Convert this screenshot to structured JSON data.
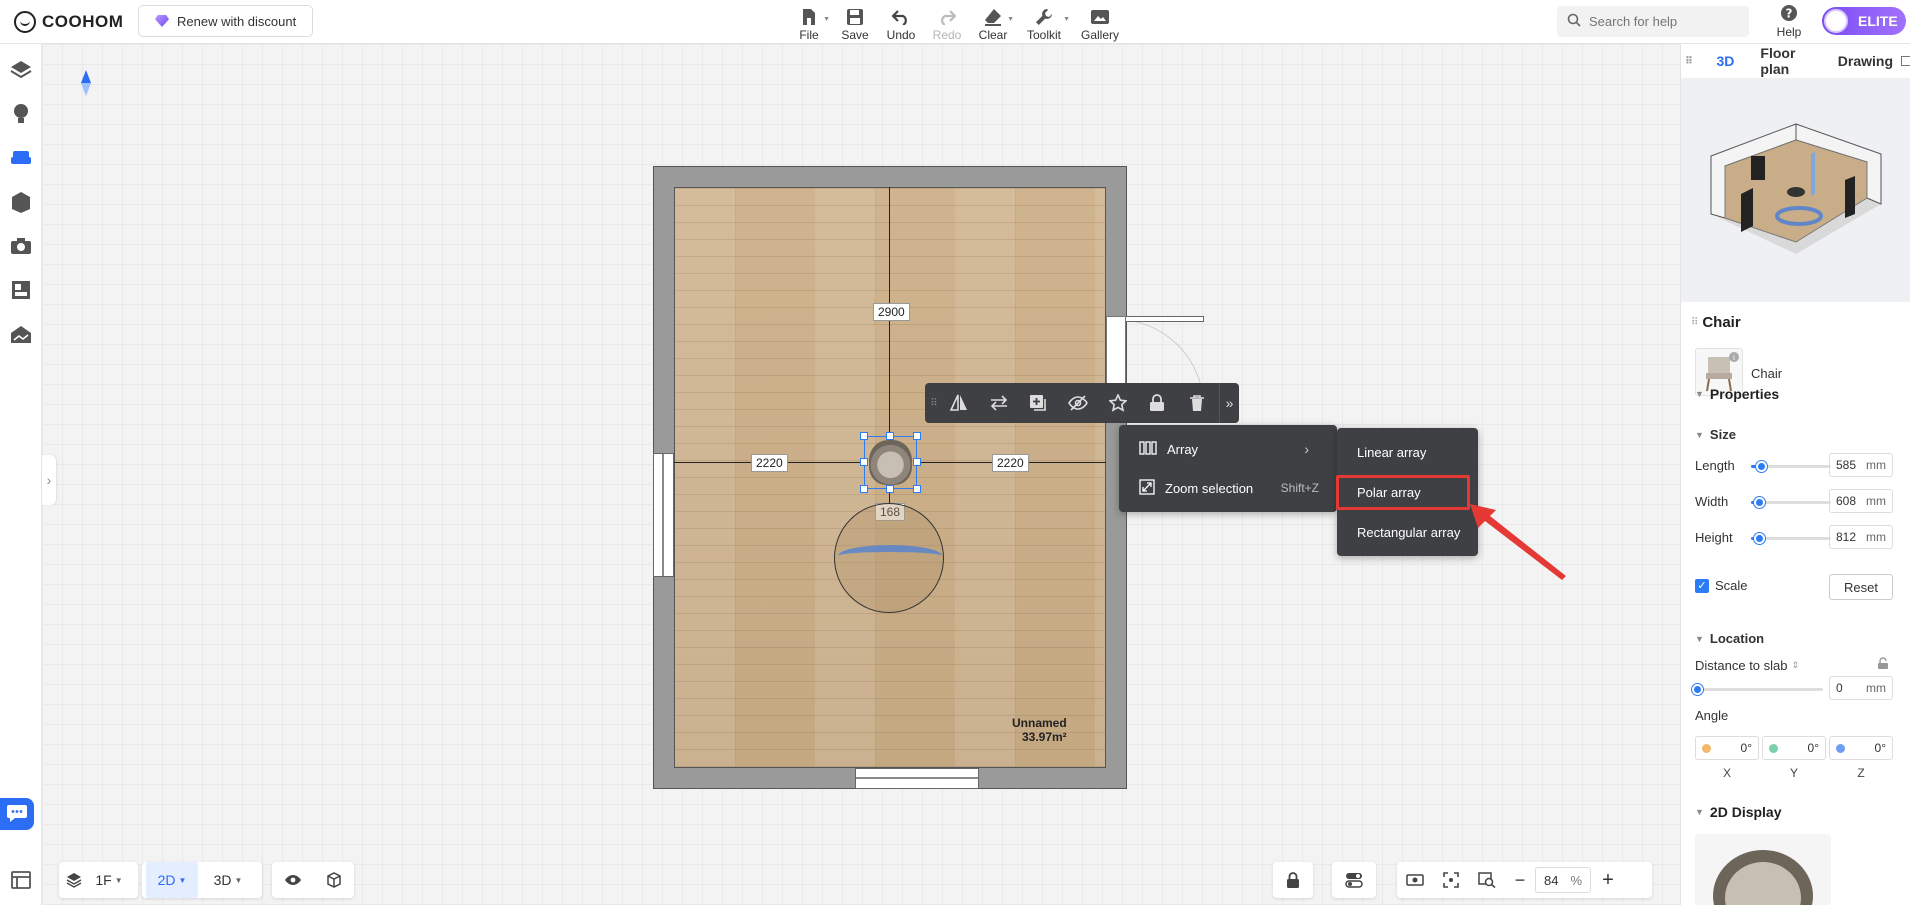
{
  "app": {
    "logo_text": "COOHOM",
    "renew_label": "Renew with discount",
    "elite_label": "ELITE"
  },
  "toolbar": {
    "file": "File",
    "save": "Save",
    "undo": "Undo",
    "redo": "Redo",
    "clear": "Clear",
    "toolkit": "Toolkit",
    "gallery": "Gallery"
  },
  "search": {
    "placeholder": "Search for help"
  },
  "help_label": "Help",
  "canvas": {
    "dim_top": "2900",
    "dim_left": "2220",
    "dim_right": "2220",
    "dim_bottom": "168",
    "room_name": "Unnamed",
    "room_area": "33.97m²"
  },
  "context_menu": {
    "array": "Array",
    "zoom_selection": "Zoom selection",
    "zoom_shortcut": "Shift+Z"
  },
  "array_submenu": {
    "linear": "Linear array",
    "polar": "Polar array",
    "rectangular": "Rectangular array"
  },
  "bottom_left": {
    "floor": "1F",
    "mode_2d": "2D",
    "mode_3d": "3D"
  },
  "zoom": {
    "value": "84",
    "unit": "%"
  },
  "right_panel": {
    "tabs": [
      "3D",
      "Floor plan",
      "Drawing"
    ],
    "object_title": "Chair",
    "object_name": "Chair",
    "properties": "Properties",
    "size": "Size",
    "length_label": "Length",
    "length_value": "585",
    "width_label": "Width",
    "width_value": "608",
    "height_label": "Height",
    "height_value": "812",
    "unit": "mm",
    "scale_label": "Scale",
    "reset_label": "Reset",
    "location": "Location",
    "distance_label": "Distance to slab",
    "distance_value": "0",
    "angle_label": "Angle",
    "angle_x": "0°",
    "angle_y": "0°",
    "angle_z": "0°",
    "axis_x": "X",
    "axis_y": "Y",
    "axis_z": "Z",
    "display_2d": "2D Display"
  },
  "colors": {
    "accent": "#2b6df5",
    "elite": "#7b4df2",
    "highlight": "#e53935",
    "menu_bg": "#3e4043"
  }
}
